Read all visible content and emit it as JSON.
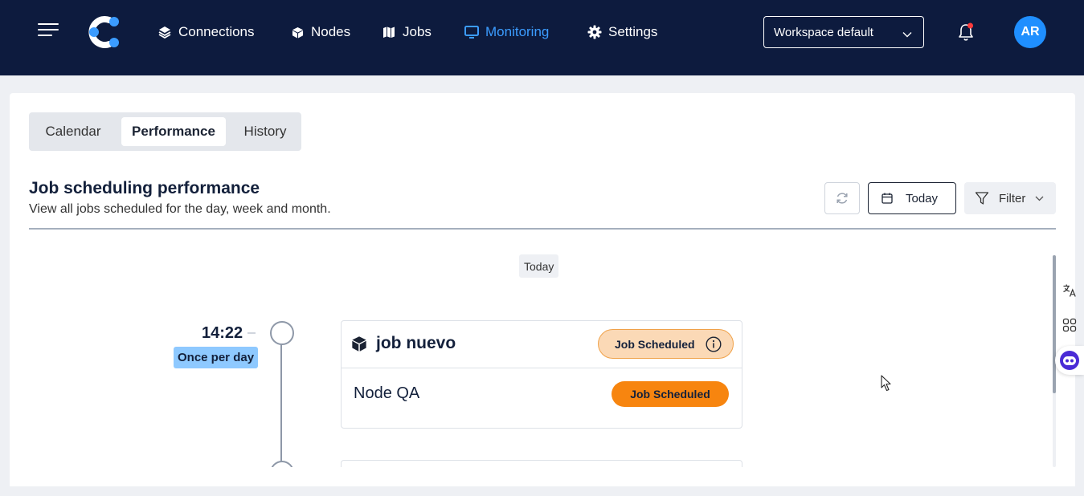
{
  "nav": {
    "items": [
      {
        "label": "Connections",
        "icon": "layers-icon"
      },
      {
        "label": "Nodes",
        "icon": "cube-icon"
      },
      {
        "label": "Jobs",
        "icon": "map-icon"
      },
      {
        "label": "Monitoring",
        "icon": "monitor-icon",
        "active": true
      },
      {
        "label": "Settings",
        "icon": "gear-icon"
      }
    ],
    "workspace": "Workspace default",
    "avatar": "AR",
    "colors": {
      "background": "#0d1b3e",
      "active": "#3b9cff",
      "avatar": "#1f8fff",
      "notification": "#ff3b3b"
    }
  },
  "tabs": [
    {
      "label": "Calendar"
    },
    {
      "label": "Performance",
      "active": true
    },
    {
      "label": "History"
    }
  ],
  "header": {
    "title": "Job scheduling performance",
    "subtitle": "View all jobs scheduled for the day, week and month.",
    "today_button": "Today",
    "filter_button": "Filter"
  },
  "timeline": {
    "day_label": "Today",
    "entries": [
      {
        "time": "14:22",
        "frequency": "Once per day",
        "job_name": "job nuevo",
        "job_status": "Job Scheduled",
        "node_name": "Node QA",
        "node_status": "Job Scheduled"
      }
    ]
  }
}
